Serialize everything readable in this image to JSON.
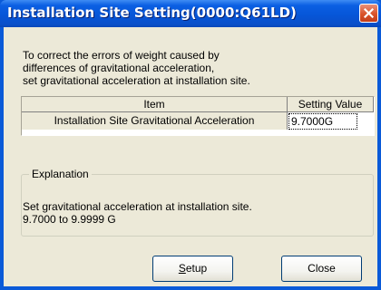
{
  "window": {
    "title": "Installation Site Setting(0000:Q61LD)"
  },
  "description": {
    "lines": [
      "To correct the errors of weight caused by",
      "differences of gravitational acceleration,",
      "set gravitational acceleration at installation site."
    ]
  },
  "table": {
    "columns": [
      "Item",
      "Setting Value"
    ],
    "rows": [
      {
        "item": "Installation Site Gravitational Acceleration",
        "value": "9.7000G"
      }
    ]
  },
  "explanation": {
    "legend": "Explanation",
    "lines": [
      "Set gravitational acceleration at installation site.",
      "9.7000 to 9.9999 G"
    ]
  },
  "buttons": {
    "setup_first": "S",
    "setup_rest": "etup",
    "close": "Close"
  },
  "icons": {
    "close": "close-icon"
  },
  "colors": {
    "titlebar": "#0656d8",
    "close_button": "#d9532a",
    "dialog_background": "#ece9d8"
  }
}
